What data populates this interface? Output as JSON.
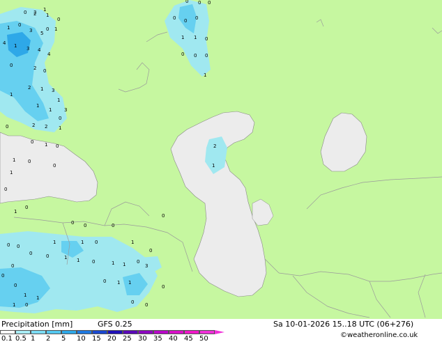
{
  "map": {
    "colors": {
      "land": "#c6f7a0",
      "water": "#ececec",
      "border": "#9a9a9a",
      "coast": "#888888",
      "precip_light": "#a0e8f0",
      "precip_mid": "#66d0f0",
      "precip_heavy": "#2ea8e8"
    },
    "precip_labels": [
      "0",
      "2",
      "1",
      "0",
      "1",
      "1",
      "0",
      "3",
      "5",
      "4",
      "1",
      "3",
      "4",
      "4",
      "2",
      "0",
      "0",
      "2",
      "1",
      "3",
      "1",
      "1",
      "3",
      "1",
      "1",
      "2",
      "2",
      "1",
      "1",
      "0",
      "0",
      "0",
      "0",
      "1",
      "0",
      "1",
      "1",
      "0",
      "0",
      "0",
      "0",
      "0",
      "0",
      "0",
      "0",
      "1",
      "1",
      "0",
      "1",
      "1",
      "0",
      "1",
      "1",
      "0",
      "3",
      "0",
      "1",
      "0",
      "0",
      "0",
      "0",
      "1",
      "1",
      "0",
      "1",
      "0",
      "1",
      "1",
      "0",
      "0",
      "0",
      "0",
      "0",
      "0",
      "0",
      "0",
      "0",
      "1",
      "1",
      "0",
      "0",
      "0",
      "0",
      "1",
      "2",
      "1",
      "3",
      "0",
      "1",
      "0",
      "0"
    ]
  },
  "footer": {
    "title": "Precipitation [mm]",
    "model": "GFS 0.25",
    "datetime": "Sa 10-01-2026 15..18 UTC (06+276)",
    "credit": "©weatheronline.co.uk",
    "scale_values": [
      "0.1",
      "0.5",
      "1",
      "2",
      "5",
      "10",
      "15",
      "20",
      "25",
      "30",
      "35",
      "40",
      "45",
      "50"
    ],
    "scale_colors": [
      "#ffffff",
      "#a8ecf4",
      "#7cdcf4",
      "#54c8f0",
      "#2ea8e8",
      "#1e78e0",
      "#1a48d0",
      "#2010b8",
      "#5a08b8",
      "#8c08c0",
      "#b808c8",
      "#d810c8",
      "#f018c8",
      "#f030d8"
    ]
  }
}
